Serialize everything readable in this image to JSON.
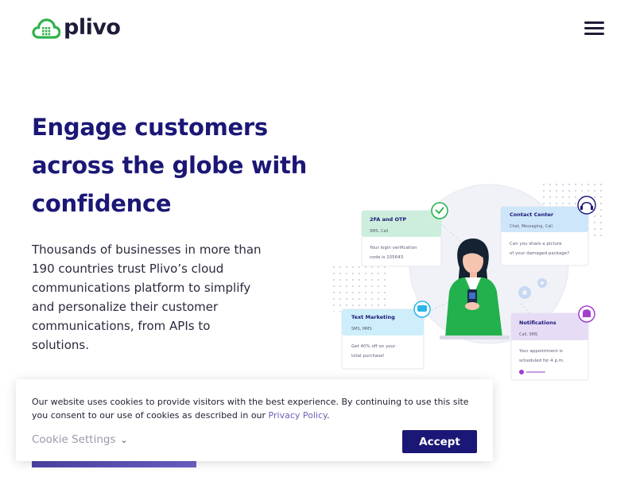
{
  "header": {
    "logo_text": "plivo",
    "menu_icon": "hamburger-menu-icon"
  },
  "hero": {
    "title": "Engage customers across the globe with confidence",
    "description": "Thousands of businesses in more than 190 countries trust Plivo’s cloud communications platform to simplify and personalize their customer communications, from APIs to solutions."
  },
  "illustration": {
    "cards": [
      {
        "title": "2FA and OTP",
        "subtitle": "SMS, Call",
        "line1": "Your login verification",
        "line2": "code is 105643"
      },
      {
        "title": "Contact Center",
        "subtitle": "Chat, Messaging, Call",
        "line1": "Can you share a picture",
        "line2": "of your damaged package?"
      },
      {
        "title": "Text Marketing",
        "subtitle": "SMS, MMS",
        "line1": "Get 40% off on your",
        "line2": "total purchase!"
      },
      {
        "title": "Notifications",
        "subtitle": "Call, SMS",
        "line1": "Your appointment is",
        "line2": "scheduled for 4 p.m."
      }
    ],
    "colors": {
      "green": "#cdeedd",
      "blue": "#cde6f9",
      "purple": "#e6dcf6",
      "navy": "#1b1776"
    }
  },
  "cookie": {
    "text_before": "Our website uses cookies to provide visitors with the best experience. By continuing to use this site you consent to our use of cookies as described in our ",
    "link_text": "Privacy Policy",
    "text_after": ".",
    "settings_label": "Cookie Settings",
    "accept_label": "Accept"
  }
}
